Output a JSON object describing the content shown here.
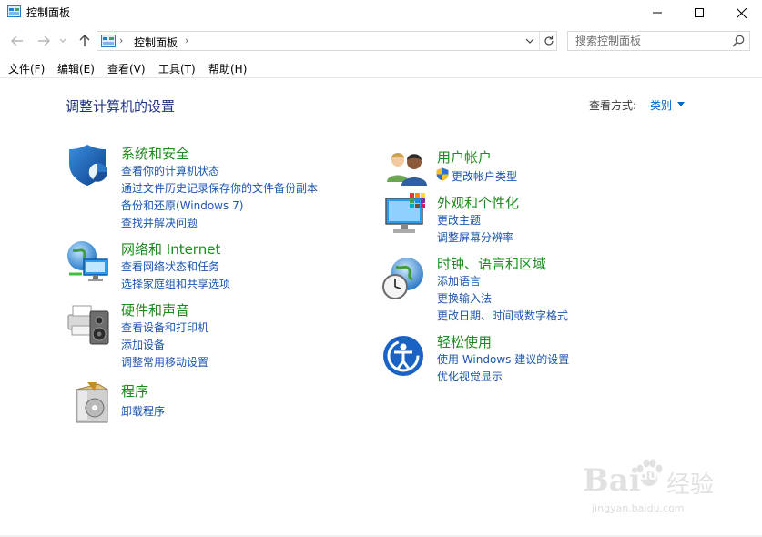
{
  "window": {
    "title": "控制面板"
  },
  "address": {
    "crumb": "控制面板",
    "sep": "›"
  },
  "search": {
    "placeholder": "搜索控制面板"
  },
  "menu": [
    "文件(F)",
    "编辑(E)",
    "查看(V)",
    "工具(T)",
    "帮助(H)"
  ],
  "main": {
    "title": "调整计算机的设置",
    "view_label": "查看方式:",
    "view_value": "类别"
  },
  "categories": {
    "security": {
      "title": "系统和安全",
      "links": [
        "查看你的计算机状态",
        "通过文件历史记录保存你的文件备份副本",
        "备份和还原(Windows 7)",
        "查找并解决问题"
      ]
    },
    "network": {
      "title": "网络和 Internet",
      "links": [
        "查看网络状态和任务",
        "选择家庭组和共享选项"
      ]
    },
    "hardware": {
      "title": "硬件和声音",
      "links": [
        "查看设备和打印机",
        "添加设备",
        "调整常用移动设置"
      ]
    },
    "programs": {
      "title": "程序",
      "links": [
        "卸载程序"
      ]
    },
    "users": {
      "title": "用户帐户",
      "links": [
        "更改帐户类型"
      ]
    },
    "appearance": {
      "title": "外观和个性化",
      "links": [
        "更改主题",
        "调整屏幕分辨率"
      ]
    },
    "clock": {
      "title": "时钟、语言和区域",
      "links": [
        "添加语言",
        "更换输入法",
        "更改日期、时间或数字格式"
      ]
    },
    "ease": {
      "title": "轻松使用",
      "links": [
        "使用 Windows 建议的设置",
        "优化视觉显示"
      ]
    }
  },
  "watermark": {
    "brand": "Bai",
    "brand2": "du",
    "suffix": "经验",
    "url": "jingyan.baidu.com"
  },
  "colors": {
    "category_title": "#1c8a1c",
    "link": "#1b55b0",
    "page_title": "#1e3287"
  }
}
